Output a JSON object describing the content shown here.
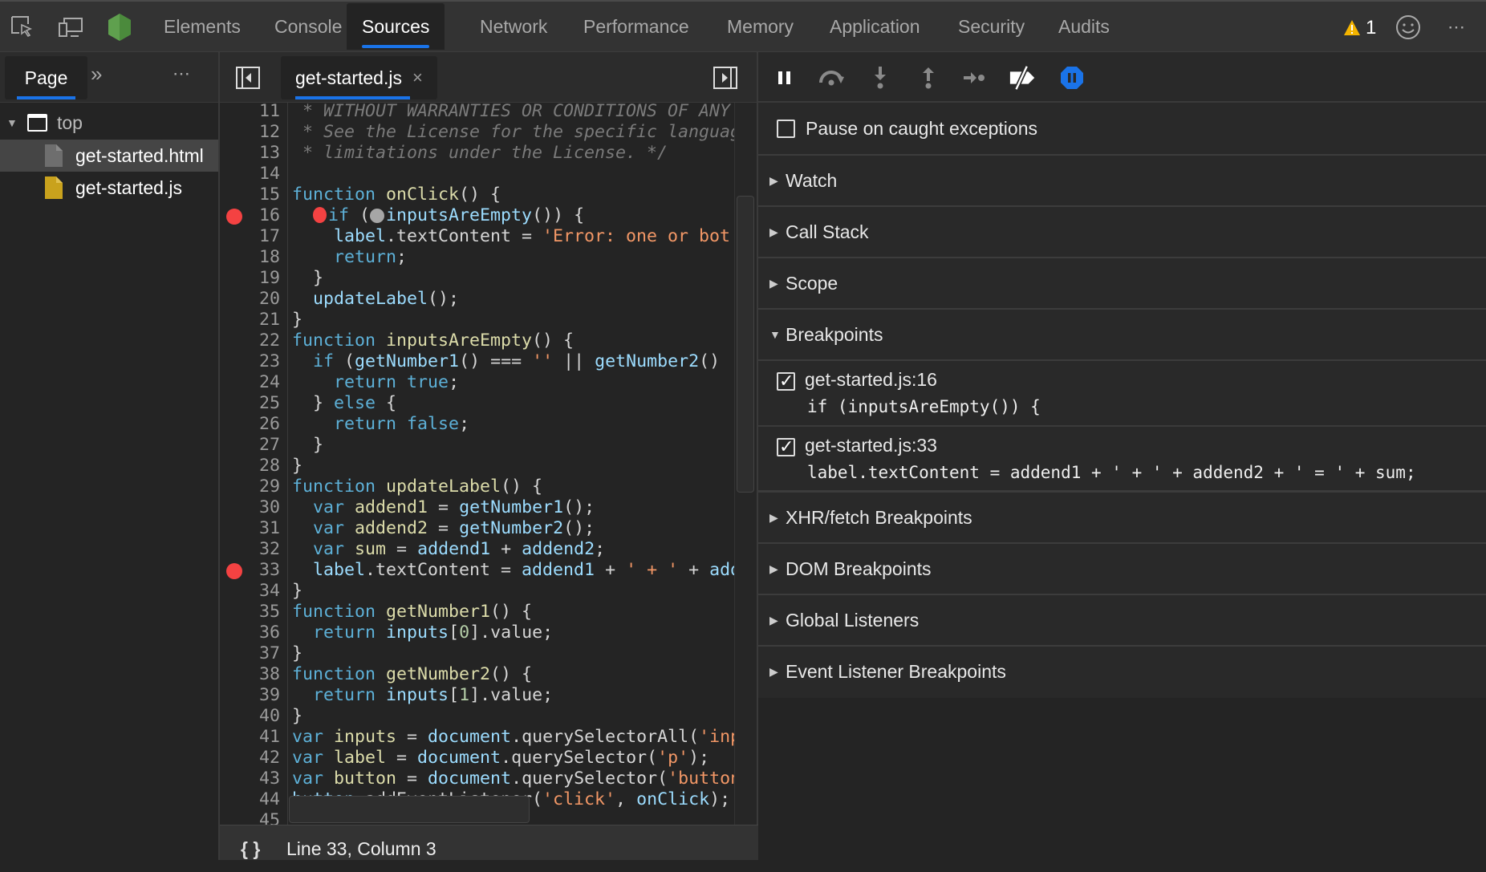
{
  "toolbar": {
    "tabs": [
      "Elements",
      "Console",
      "Sources",
      "Network",
      "Performance",
      "Memory",
      "Application",
      "Security",
      "Audits"
    ],
    "selected_tab": "Sources",
    "warning_count": "1"
  },
  "sidebar": {
    "tab": "Page",
    "tree": {
      "frame": "top",
      "files": [
        "get-started.html",
        "get-started.js"
      ],
      "selected": "get-started.html"
    }
  },
  "editor": {
    "tab": "get-started.js",
    "status": "Line 33, Column 3",
    "format_label": "{ }",
    "lines": [
      {
        "n": 11,
        "t": [
          [
            "cm",
            " * WITHOUT WARRANTIES OR CONDITIONS OF ANY K"
          ]
        ]
      },
      {
        "n": 12,
        "t": [
          [
            "cm",
            " * See the License for the specific language"
          ]
        ]
      },
      {
        "n": 13,
        "t": [
          [
            "cm",
            " * limitations under the License. */"
          ]
        ]
      },
      {
        "n": 14,
        "t": []
      },
      {
        "n": 15,
        "t": [
          [
            "kw",
            "function"
          ],
          [
            "fn",
            " onClick"
          ],
          [
            "pn",
            "() {"
          ]
        ]
      },
      {
        "n": 16,
        "bp": true,
        "t": [
          [
            "pn",
            "  "
          ],
          [
            "bpA",
            ""
          ],
          [
            "kw",
            "if"
          ],
          [
            "pn",
            " ("
          ],
          [
            "bpI",
            ""
          ],
          [
            "id",
            "inputsAreEmpty"
          ],
          [
            "pn",
            "()) {"
          ]
        ]
      },
      {
        "n": 17,
        "t": [
          [
            "pn",
            "    "
          ],
          [
            "id",
            "label"
          ],
          [
            "pn",
            ".textContent = "
          ],
          [
            "str",
            "'Error: one or bot"
          ]
        ]
      },
      {
        "n": 18,
        "t": [
          [
            "pn",
            "    "
          ],
          [
            "kw",
            "return"
          ],
          [
            "pn",
            ";"
          ]
        ]
      },
      {
        "n": 19,
        "t": [
          [
            "pn",
            "  }"
          ]
        ]
      },
      {
        "n": 20,
        "t": [
          [
            "pn",
            "  "
          ],
          [
            "id",
            "updateLabel"
          ],
          [
            "pn",
            "();"
          ]
        ]
      },
      {
        "n": 21,
        "t": [
          [
            "pn",
            "}"
          ]
        ]
      },
      {
        "n": 22,
        "t": [
          [
            "kw",
            "function"
          ],
          [
            "fn",
            " inputsAreEmpty"
          ],
          [
            "pn",
            "() {"
          ]
        ]
      },
      {
        "n": 23,
        "t": [
          [
            "pn",
            "  "
          ],
          [
            "kw",
            "if"
          ],
          [
            "pn",
            " ("
          ],
          [
            "id",
            "getNumber1"
          ],
          [
            "pn",
            "() === "
          ],
          [
            "str",
            "''"
          ],
          [
            "pn",
            " || "
          ],
          [
            "id",
            "getNumber2"
          ],
          [
            "pn",
            "()"
          ]
        ]
      },
      {
        "n": 24,
        "t": [
          [
            "pn",
            "    "
          ],
          [
            "kw",
            "return"
          ],
          [
            "pn",
            " "
          ],
          [
            "kw",
            "true"
          ],
          [
            "pn",
            ";"
          ]
        ]
      },
      {
        "n": 25,
        "t": [
          [
            "pn",
            "  } "
          ],
          [
            "kw",
            "else"
          ],
          [
            "pn",
            " {"
          ]
        ]
      },
      {
        "n": 26,
        "t": [
          [
            "pn",
            "    "
          ],
          [
            "kw",
            "return"
          ],
          [
            "pn",
            " "
          ],
          [
            "kw",
            "false"
          ],
          [
            "pn",
            ";"
          ]
        ]
      },
      {
        "n": 27,
        "t": [
          [
            "pn",
            "  }"
          ]
        ]
      },
      {
        "n": 28,
        "t": [
          [
            "pn",
            "}"
          ]
        ]
      },
      {
        "n": 29,
        "t": [
          [
            "kw",
            "function"
          ],
          [
            "fn",
            " updateLabel"
          ],
          [
            "pn",
            "() {"
          ]
        ]
      },
      {
        "n": 30,
        "t": [
          [
            "pn",
            "  "
          ],
          [
            "kw",
            "var"
          ],
          [
            "fn",
            " addend1"
          ],
          [
            "pn",
            " = "
          ],
          [
            "id",
            "getNumber1"
          ],
          [
            "pn",
            "();"
          ]
        ]
      },
      {
        "n": 31,
        "t": [
          [
            "pn",
            "  "
          ],
          [
            "kw",
            "var"
          ],
          [
            "fn",
            " addend2"
          ],
          [
            "pn",
            " = "
          ],
          [
            "id",
            "getNumber2"
          ],
          [
            "pn",
            "();"
          ]
        ]
      },
      {
        "n": 32,
        "t": [
          [
            "pn",
            "  "
          ],
          [
            "kw",
            "var"
          ],
          [
            "fn",
            " sum"
          ],
          [
            "pn",
            " = "
          ],
          [
            "id",
            "addend1"
          ],
          [
            "pn",
            " + "
          ],
          [
            "id",
            "addend2"
          ],
          [
            "pn",
            ";"
          ]
        ]
      },
      {
        "n": 33,
        "bp": true,
        "t": [
          [
            "pn",
            "  "
          ],
          [
            "id",
            "label"
          ],
          [
            "pn",
            ".textContent = "
          ],
          [
            "id",
            "addend1"
          ],
          [
            "pn",
            " + "
          ],
          [
            "str",
            "' + '"
          ],
          [
            "pn",
            " + "
          ],
          [
            "id",
            "adde"
          ]
        ]
      },
      {
        "n": 34,
        "t": [
          [
            "pn",
            "}"
          ]
        ]
      },
      {
        "n": 35,
        "t": [
          [
            "kw",
            "function"
          ],
          [
            "fn",
            " getNumber1"
          ],
          [
            "pn",
            "() {"
          ]
        ]
      },
      {
        "n": 36,
        "t": [
          [
            "pn",
            "  "
          ],
          [
            "kw",
            "return"
          ],
          [
            "pn",
            " "
          ],
          [
            "id",
            "inputs"
          ],
          [
            "pn",
            "["
          ],
          [
            "num",
            "0"
          ],
          [
            "pn",
            "].value;"
          ]
        ]
      },
      {
        "n": 37,
        "t": [
          [
            "pn",
            "}"
          ]
        ]
      },
      {
        "n": 38,
        "t": [
          [
            "kw",
            "function"
          ],
          [
            "fn",
            " getNumber2"
          ],
          [
            "pn",
            "() {"
          ]
        ]
      },
      {
        "n": 39,
        "t": [
          [
            "pn",
            "  "
          ],
          [
            "kw",
            "return"
          ],
          [
            "pn",
            " "
          ],
          [
            "id",
            "inputs"
          ],
          [
            "pn",
            "["
          ],
          [
            "num",
            "1"
          ],
          [
            "pn",
            "].value;"
          ]
        ]
      },
      {
        "n": 40,
        "t": [
          [
            "pn",
            "}"
          ]
        ]
      },
      {
        "n": 41,
        "t": [
          [
            "kw",
            "var"
          ],
          [
            "fn",
            " inputs"
          ],
          [
            "pn",
            " = "
          ],
          [
            "id",
            "document"
          ],
          [
            "pn",
            ".querySelectorAll("
          ],
          [
            "str",
            "'inpu"
          ]
        ]
      },
      {
        "n": 42,
        "t": [
          [
            "kw",
            "var"
          ],
          [
            "fn",
            " label"
          ],
          [
            "pn",
            " = "
          ],
          [
            "id",
            "document"
          ],
          [
            "pn",
            ".querySelector("
          ],
          [
            "str",
            "'p'"
          ],
          [
            "pn",
            ");"
          ]
        ]
      },
      {
        "n": 43,
        "t": [
          [
            "kw",
            "var"
          ],
          [
            "fn",
            " button"
          ],
          [
            "pn",
            " = "
          ],
          [
            "id",
            "document"
          ],
          [
            "pn",
            ".querySelector("
          ],
          [
            "str",
            "'button'"
          ]
        ]
      },
      {
        "n": 44,
        "t": [
          [
            "id",
            "button"
          ],
          [
            "pn",
            ".addEventListener("
          ],
          [
            "str",
            "'click'"
          ],
          [
            "pn",
            ", "
          ],
          [
            "id",
            "onClick"
          ],
          [
            "pn",
            ");"
          ]
        ]
      },
      {
        "n": 45,
        "t": []
      }
    ]
  },
  "debugger": {
    "pause_on_caught": {
      "label": "Pause on caught exceptions",
      "checked": false
    },
    "sections": {
      "watch": "Watch",
      "call_stack": "Call Stack",
      "scope": "Scope",
      "breakpoints": "Breakpoints",
      "xhr": "XHR/fetch Breakpoints",
      "dom": "DOM Breakpoints",
      "global": "Global Listeners",
      "event": "Event Listener Breakpoints"
    },
    "breakpoints": [
      {
        "location": "get-started.js:16",
        "code": "if (inputsAreEmpty()) {",
        "checked": true
      },
      {
        "location": "get-started.js:33",
        "code": "label.textContent = addend1 + ' + ' + addend2 + ' = ' + sum;",
        "checked": true
      }
    ],
    "accent": "#1a73e8"
  }
}
